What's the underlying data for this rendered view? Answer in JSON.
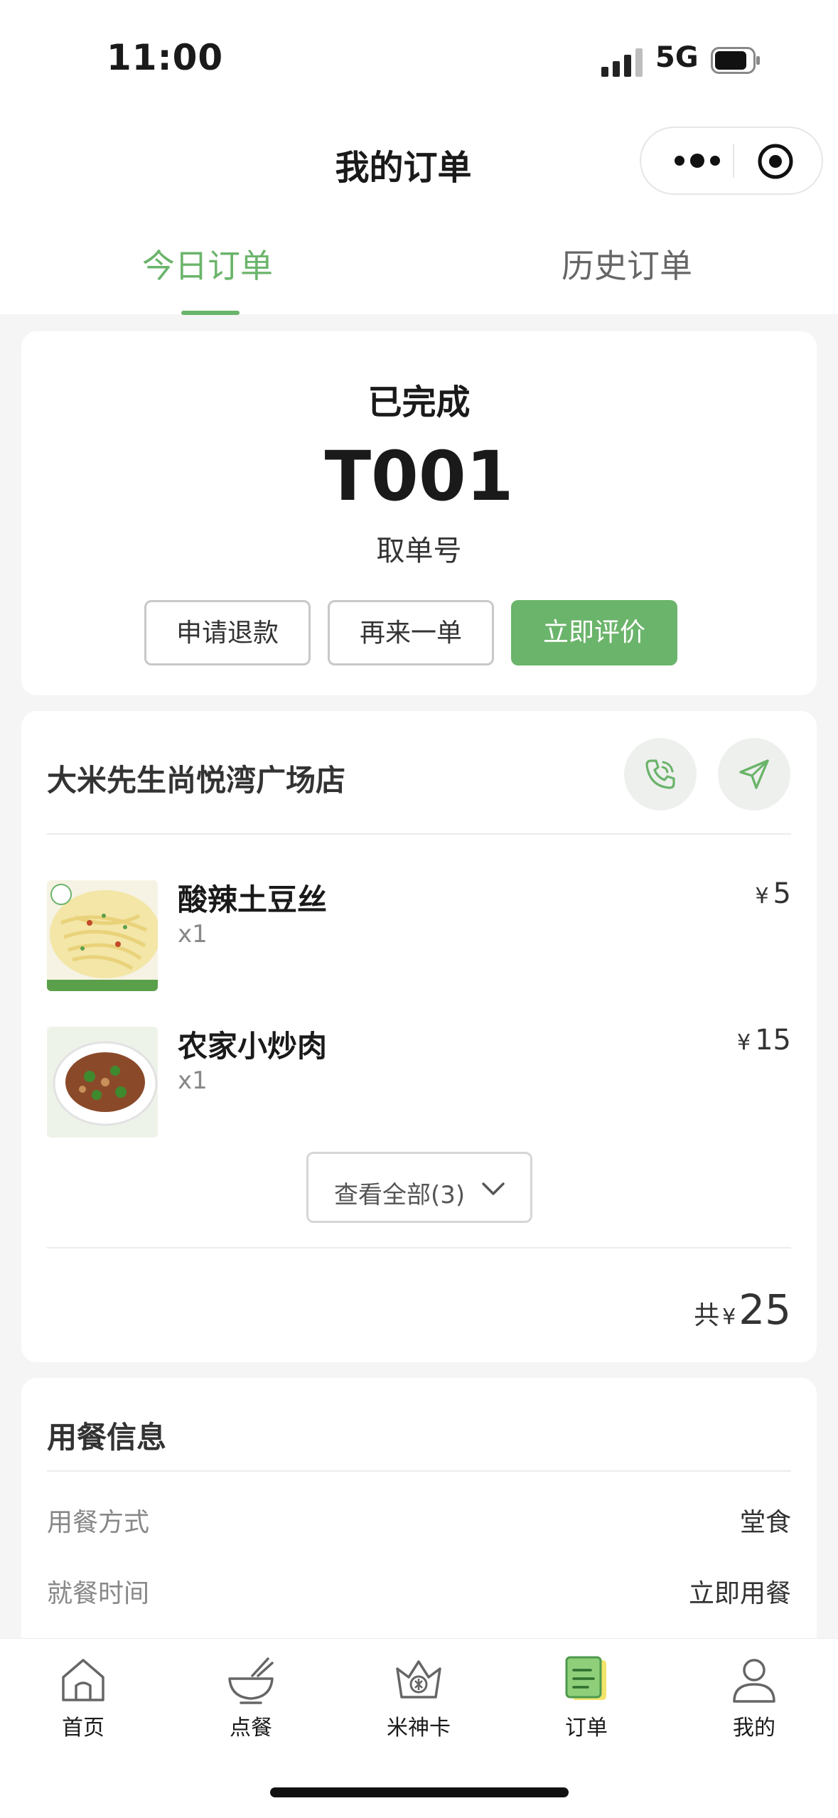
{
  "status_bar": {
    "time": "11:00",
    "network": "5G"
  },
  "nav": {
    "title": "我的订单"
  },
  "tabs": [
    {
      "label": "今日订单",
      "active": true
    },
    {
      "label": "历史订单",
      "active": false
    }
  ],
  "order": {
    "status": "已完成",
    "pickup_number": "T001",
    "pickup_label": "取单号",
    "actions": {
      "refund": "申请退款",
      "reorder": "再来一单",
      "review": "立即评价"
    }
  },
  "store": {
    "name": "大米先生尚悦湾广场店"
  },
  "items": [
    {
      "name": "酸辣土豆丝",
      "qty": "x1",
      "currency": "¥",
      "price": "5"
    },
    {
      "name": "农家小炒肉",
      "qty": "x1",
      "currency": "¥",
      "price": "15"
    }
  ],
  "view_all": "查看全部(3)",
  "total": {
    "prefix": "共",
    "currency": "¥",
    "amount": "25"
  },
  "dining": {
    "title": "用餐信息",
    "rows": [
      {
        "label": "用餐方式",
        "value": "堂食"
      },
      {
        "label": "就餐时间",
        "value": "立即用餐"
      }
    ]
  },
  "bottom_tabs": [
    {
      "label": "首页",
      "icon": "home-icon"
    },
    {
      "label": "点餐",
      "icon": "bowl-icon"
    },
    {
      "label": "米神卡",
      "icon": "crown-card-icon"
    },
    {
      "label": "订单",
      "icon": "order-icon",
      "active": true
    },
    {
      "label": "我的",
      "icon": "profile-icon"
    }
  ],
  "colors": {
    "accent": "#6bb46b",
    "background": "#f5f5f5"
  }
}
